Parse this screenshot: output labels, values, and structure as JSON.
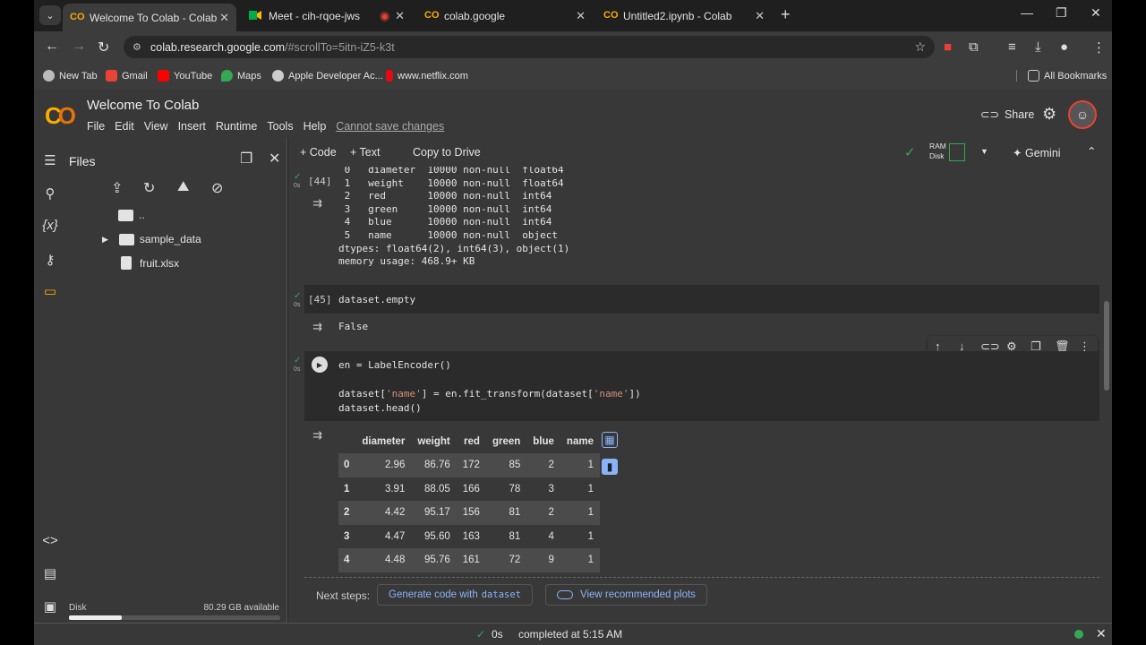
{
  "browser": {
    "tabs": [
      {
        "label": "Welcome To Colab - Colab",
        "active": true
      },
      {
        "label": "Meet - cih-rqoe-jws",
        "active": false
      },
      {
        "label": "colab.google",
        "active": false
      },
      {
        "label": "Untitled2.ipynb - Colab",
        "active": false
      }
    ],
    "url_host": "colab.research.google.com",
    "url_path": "/#scrollTo=5itn-iZ5-k3t",
    "bookmarks": [
      "New Tab",
      "Gmail",
      "YouTube",
      "Maps",
      "Apple Developer Ac...",
      "www.netflix.com"
    ],
    "all_bookmarks": "All Bookmarks"
  },
  "colab": {
    "title": "Welcome To Colab",
    "menu": [
      "File",
      "Edit",
      "View",
      "Insert",
      "Runtime",
      "Tools",
      "Help"
    ],
    "cannot_save": "Cannot save changes",
    "share": "Share",
    "accent_color": "#f9ab00"
  },
  "sidebar": {
    "title": "Files",
    "items": [
      {
        "label": "..",
        "kind": "folder"
      },
      {
        "label": "sample_data",
        "kind": "folder"
      },
      {
        "label": "fruit.xlsx",
        "kind": "file"
      }
    ],
    "disk_label": "Disk",
    "disk_available": "80.29 GB available",
    "disk_used_fraction": 0.25
  },
  "toolbar": {
    "code": "Code",
    "text": "Text",
    "copy_to_drive": "Copy to Drive",
    "ram": "RAM",
    "disk": "Disk",
    "gemini": "Gemini"
  },
  "cells": {
    "c44": {
      "prompt": "[44]",
      "exec": "0s",
      "output": " 0   diameter  10000 non-null  float64\n 1   weight    10000 non-null  float64\n 2   red       10000 non-null  int64\n 3   green     10000 non-null  int64\n 4   blue      10000 non-null  int64\n 5   name      10000 non-null  object\ndtypes: float64(2), int64(3), object(1)\nmemory usage: 468.9+ KB"
    },
    "c45": {
      "prompt": "[45]",
      "exec": "0s",
      "code": "dataset.empty",
      "output": "False"
    },
    "c46": {
      "exec": "0s",
      "line1": "en = LabelEncoder()",
      "line2a": "dataset[",
      "line2s1": "'name'",
      "line2b": "] = en.fit_transform(dataset[",
      "line2s2": "'name'",
      "line2c": "])",
      "line3": "dataset.head()"
    }
  },
  "dataframe": {
    "columns": [
      "",
      "diameter",
      "weight",
      "red",
      "green",
      "blue",
      "name"
    ],
    "rows": [
      [
        "0",
        "2.96",
        "86.76",
        "172",
        "85",
        "2",
        "1"
      ],
      [
        "1",
        "3.91",
        "88.05",
        "166",
        "78",
        "3",
        "1"
      ],
      [
        "2",
        "4.42",
        "95.17",
        "156",
        "81",
        "2",
        "1"
      ],
      [
        "3",
        "4.47",
        "95.60",
        "163",
        "81",
        "4",
        "1"
      ],
      [
        "4",
        "4.48",
        "95.76",
        "161",
        "72",
        "9",
        "1"
      ]
    ]
  },
  "next_steps": {
    "label": "Next steps:",
    "generate": "Generate code with",
    "generate_code": "dataset",
    "recommended": "View recommended plots"
  },
  "status": {
    "time": "0s",
    "completed": "completed at 5:15 AM"
  }
}
